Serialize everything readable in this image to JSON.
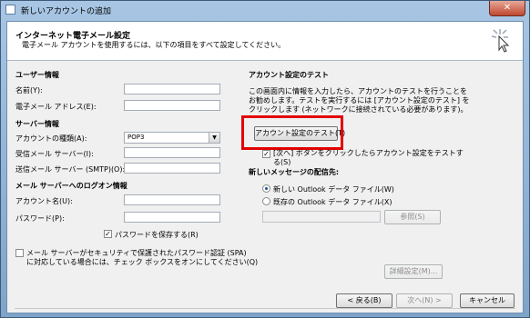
{
  "window": {
    "title": "新しいアカウントの追加",
    "close_glyph": "✕"
  },
  "header": {
    "title": "インターネット電子メール設定",
    "subtitle": "電子メール アカウントを使用するには、以下の項目をすべて設定してください。"
  },
  "user_info": {
    "heading": "ユーザー情報",
    "name_label": "名前(Y):",
    "email_label": "電子メール アドレス(E):",
    "name_value": "",
    "email_value": ""
  },
  "server_info": {
    "heading": "サーバー情報",
    "account_type_label": "アカウントの種類(A):",
    "account_type_value": "POP3",
    "incoming_label": "受信メール サーバー(I):",
    "outgoing_label": "送信メール サーバー (SMTP)(O):",
    "incoming_value": "",
    "outgoing_value": ""
  },
  "logon_info": {
    "heading": "メール サーバーへのログオン情報",
    "account_name_label": "アカウント名(U):",
    "password_label": "パスワード(P):",
    "account_name_value": "",
    "password_value": "",
    "remember_password_label": "パスワードを保存する(R)",
    "remember_password_checked": true,
    "spa_label_line1": "メール サーバーがセキュリティで保護されたパスワード認証 (SPA)",
    "spa_label_line2": "に対応している場合には、チェック ボックスをオンにしてください(Q)",
    "spa_checked": false
  },
  "test": {
    "heading": "アカウント設定のテスト",
    "description_line1": "この画面内に情報を入力したら、アカウントのテストを行うことを",
    "description_line2": "お勧めします。テストを実行するには [アカウント設定のテスト] を",
    "description_line3": "クリックします (ネットワークに接続されている必要があります)。",
    "test_button_label": "アカウント設定のテスト(T)",
    "auto_test_label_line1": "[次へ] ボタンをクリックしたらアカウント設定をテストす",
    "auto_test_label_line2": "る(S)",
    "auto_test_checked": true
  },
  "delivery": {
    "heading": "新しいメッセージの配信先:",
    "option_new": "新しい Outlook データ ファイル(W)",
    "option_existing": "既存の Outlook データ ファイル(X)",
    "selected": "new",
    "browse_label": "参照(S)",
    "path_value": ""
  },
  "buttons": {
    "more_settings": "詳細設定(M)...",
    "back": "< 戻る(B)",
    "next": "次へ(N) >",
    "cancel": "キャンセル"
  },
  "colors": {
    "highlight": "#e30000"
  }
}
